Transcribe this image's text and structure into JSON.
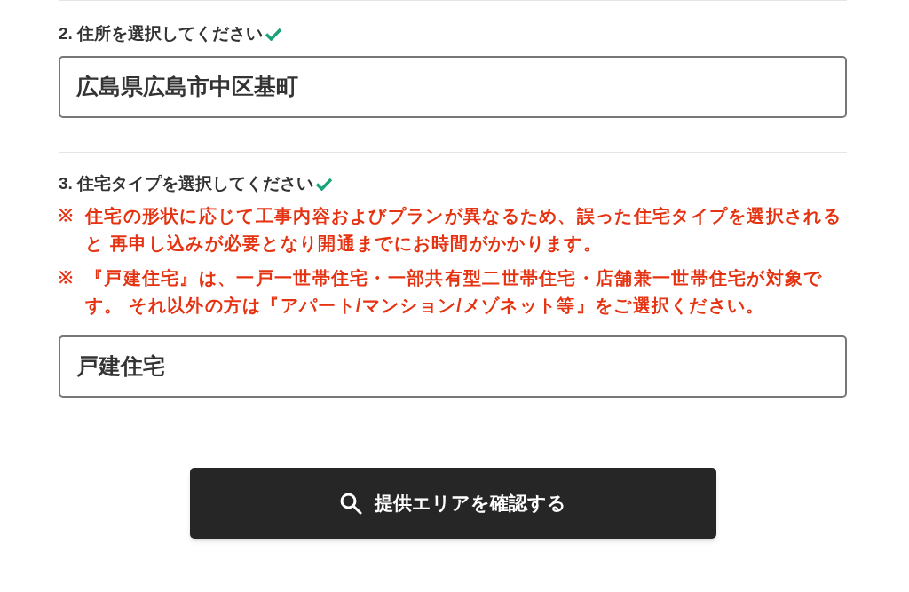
{
  "sections": [
    {
      "label": "2. 住所を選択してください",
      "completed": true,
      "value": "広島県広島市中区基町"
    },
    {
      "label": "3. 住宅タイプを選択してください",
      "completed": true,
      "notes": [
        {
          "mark": "※",
          "text": "住宅の形状に応じて工事内容およびプランが異なるため、誤った住宅タイプを選択されると 再申し込みが必要となり開通までにお時間がかかります。"
        },
        {
          "mark": "※",
          "text": "『戸建住宅』は、一戸一世帯住宅・一部共有型二世帯住宅・店舗兼一世帯住宅が対象です。 それ以外の方は『アパート/マンション/メゾネット等』をご選択ください。"
        }
      ],
      "value": "戸建住宅"
    }
  ],
  "submit_button": {
    "label": "提供エリアを確認する"
  }
}
